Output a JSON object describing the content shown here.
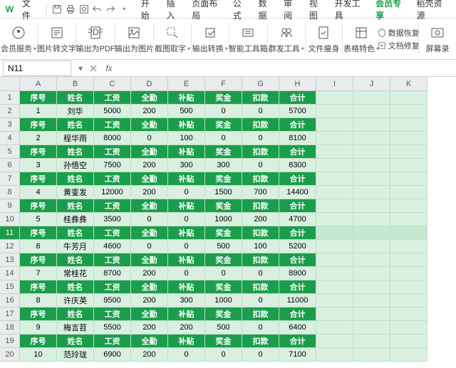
{
  "menubar": {
    "logo": "W",
    "file": "文件",
    "tabs": [
      "开始",
      "插入",
      "页面布局",
      "公式",
      "数据",
      "审阅",
      "视图",
      "开发工具",
      "会员专享",
      "稻壳资源"
    ],
    "vip_index": 8
  },
  "ribbon": [
    {
      "label": "会员服务",
      "dd": true
    },
    {
      "label": "图片转文字"
    },
    {
      "label": "输出为PDF"
    },
    {
      "label": "输出为图片"
    },
    {
      "label": "截图取字",
      "dd": true
    },
    {
      "label": "输出转换",
      "dd": true
    },
    {
      "label": "智能工具箱"
    },
    {
      "label": "群发工具",
      "dd": true
    },
    {
      "label": "文件瘦身"
    },
    {
      "label": "表格特色",
      "dd": true
    },
    {
      "label": "数据恢复",
      "sub": "文档修复",
      "stacked": true
    },
    {
      "label": "屏幕录"
    }
  ],
  "namebox": {
    "ref": "N11"
  },
  "columns": [
    "A",
    "B",
    "C",
    "D",
    "E",
    "F",
    "G",
    "H",
    "I",
    "J",
    "K"
  ],
  "header_labels": [
    "序号",
    "姓名",
    "工资",
    "全勤",
    "补贴",
    "奖金",
    "扣款",
    "合计"
  ],
  "data_rows": [
    [
      "1",
      "刘华",
      "5000",
      "200",
      "500",
      "0",
      "0",
      "5700"
    ],
    [
      "2",
      "程华雨",
      "8000",
      "0",
      "100",
      "0",
      "0",
      "8100"
    ],
    [
      "3",
      "孙悟空",
      "7500",
      "200",
      "300",
      "300",
      "0",
      "8300"
    ],
    [
      "4",
      "黄銮发",
      "12000",
      "200",
      "0",
      "1500",
      "700",
      "14400"
    ],
    [
      "5",
      "桂彝彝",
      "3500",
      "0",
      "0",
      "1000",
      "200",
      "4700"
    ],
    [
      "6",
      "牛芳月",
      "4600",
      "0",
      "0",
      "500",
      "100",
      "5200"
    ],
    [
      "7",
      "常桂花",
      "8700",
      "200",
      "0",
      "0",
      "0",
      "8900"
    ],
    [
      "8",
      "许庆英",
      "9500",
      "200",
      "300",
      "1000",
      "0",
      "11000"
    ],
    [
      "9",
      "梅言苕",
      "5500",
      "200",
      "200",
      "500",
      "0",
      "6400"
    ],
    [
      "10",
      "范玲珑",
      "6900",
      "200",
      "0",
      "0",
      "0",
      "7100"
    ]
  ],
  "selected_row": 11
}
